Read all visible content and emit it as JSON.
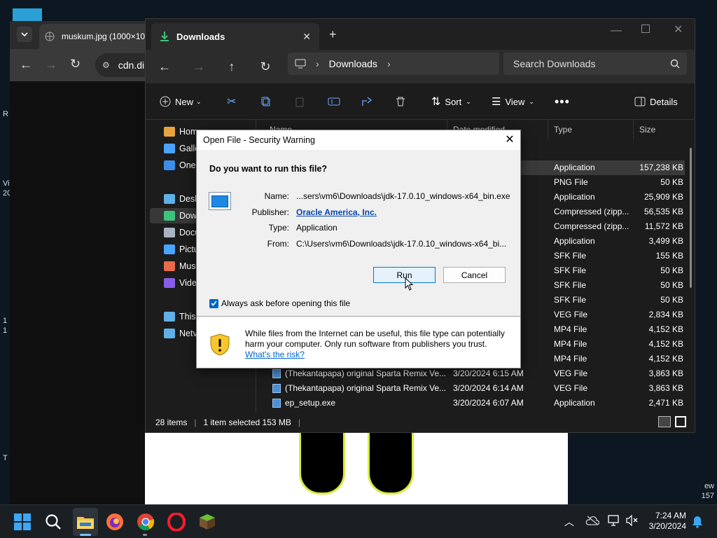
{
  "desktop": {
    "left_texts": [
      "R",
      "Vi",
      "20",
      "1",
      "1",
      "T"
    ],
    "right_texts": [
      "ew",
      "157"
    ]
  },
  "browser": {
    "tab_title": "muskum.jpg (1000×100",
    "address": "cdn.di"
  },
  "explorer": {
    "tab_title": "Downloads",
    "breadcrumb": "Downloads",
    "search_placeholder": "Search Downloads",
    "commands": {
      "new": "New",
      "sort": "Sort",
      "view": "View",
      "details": "Details"
    },
    "sidebar": [
      {
        "label": "Home",
        "color": "#e8a33d"
      },
      {
        "label": "Galle",
        "color": "#4aa3ff"
      },
      {
        "label": "OneI",
        "color": "#3b8ee8"
      },
      {
        "label": "Desk",
        "color": "#5fb0e8"
      },
      {
        "label": "Dow",
        "color": "#3ec37b"
      },
      {
        "label": "Docu",
        "color": "#a9b4c2"
      },
      {
        "label": "Pictu",
        "color": "#4aa3ff"
      },
      {
        "label": "Musi",
        "color": "#e86a4a"
      },
      {
        "label": "Vide",
        "color": "#8a5ce8"
      },
      {
        "label": "This",
        "color": "#5fb0e8"
      },
      {
        "label": "Netv",
        "color": "#5fb0e8"
      }
    ],
    "columns": {
      "name": "Name",
      "date": "Date modified",
      "type": "Type",
      "size": "Size"
    },
    "rows": [
      {
        "name": "",
        "date": "",
        "type": "Application",
        "size": "157,238 KB",
        "selected": true
      },
      {
        "name": "",
        "date": "",
        "type": "PNG File",
        "size": "50 KB"
      },
      {
        "name": "",
        "date": "",
        "type": "Application",
        "size": "25,909 KB"
      },
      {
        "name": "",
        "date": "",
        "type": "Compressed (zipp...",
        "size": "56,535 KB"
      },
      {
        "name": "",
        "date": "",
        "type": "Compressed (zipp...",
        "size": "11,572 KB"
      },
      {
        "name": "",
        "date": "",
        "type": "Application",
        "size": "3,499 KB"
      },
      {
        "name": "",
        "date": "",
        "type": "SFK File",
        "size": "155 KB"
      },
      {
        "name": "",
        "date": "",
        "type": "SFK File",
        "size": "50 KB"
      },
      {
        "name": "",
        "date": "",
        "type": "SFK File",
        "size": "50 KB"
      },
      {
        "name": "",
        "date": "",
        "type": "SFK File",
        "size": "50 KB"
      },
      {
        "name": "",
        "date": "",
        "type": "VEG File",
        "size": "2,834 KB"
      },
      {
        "name": "",
        "date": "",
        "type": "MP4 File",
        "size": "4,152 KB"
      },
      {
        "name": "",
        "date": "",
        "type": "MP4 File",
        "size": "4,152 KB"
      },
      {
        "name": "",
        "date": "",
        "type": "MP4 File",
        "size": "4,152 KB"
      },
      {
        "name": "(Thekantapapa) original Sparta Remix Ve...",
        "date": "3/20/2024 6:15 AM",
        "type": "VEG File",
        "size": "3,863 KB"
      },
      {
        "name": "(Thekantapapa) original Sparta Remix Ve...",
        "date": "3/20/2024 6:14 AM",
        "type": "VEG File",
        "size": "3,863 KB"
      },
      {
        "name": "ep_setup.exe",
        "date": "3/20/2024 6:07 AM",
        "type": "Application",
        "size": "2,471 KB"
      }
    ],
    "status": {
      "count": "28 items",
      "selected": "1 item selected  153 MB"
    }
  },
  "dialog": {
    "title": "Open File - Security Warning",
    "question": "Do you want to run this file?",
    "labels": {
      "name": "Name:",
      "publisher": "Publisher:",
      "type": "Type:",
      "from": "From:"
    },
    "values": {
      "name": "...sers\\vm6\\Downloads\\jdk-17.0.10_windows-x64_bin.exe",
      "publisher": "Oracle America, Inc.",
      "type": "Application",
      "from": "C:\\Users\\vm6\\Downloads\\jdk-17.0.10_windows-x64_bi..."
    },
    "run_label": "Run",
    "cancel_label": "Cancel",
    "checkbox_label": "Always ask before opening this file",
    "warning_line1": "While files from the Internet can be useful, this file type can potentially",
    "warning_line2": "harm your computer. Only run software from publishers you trust.",
    "warning_link": "What's the risk?"
  },
  "taskbar": {
    "time": "7:24 AM",
    "date": "3/20/2024"
  }
}
